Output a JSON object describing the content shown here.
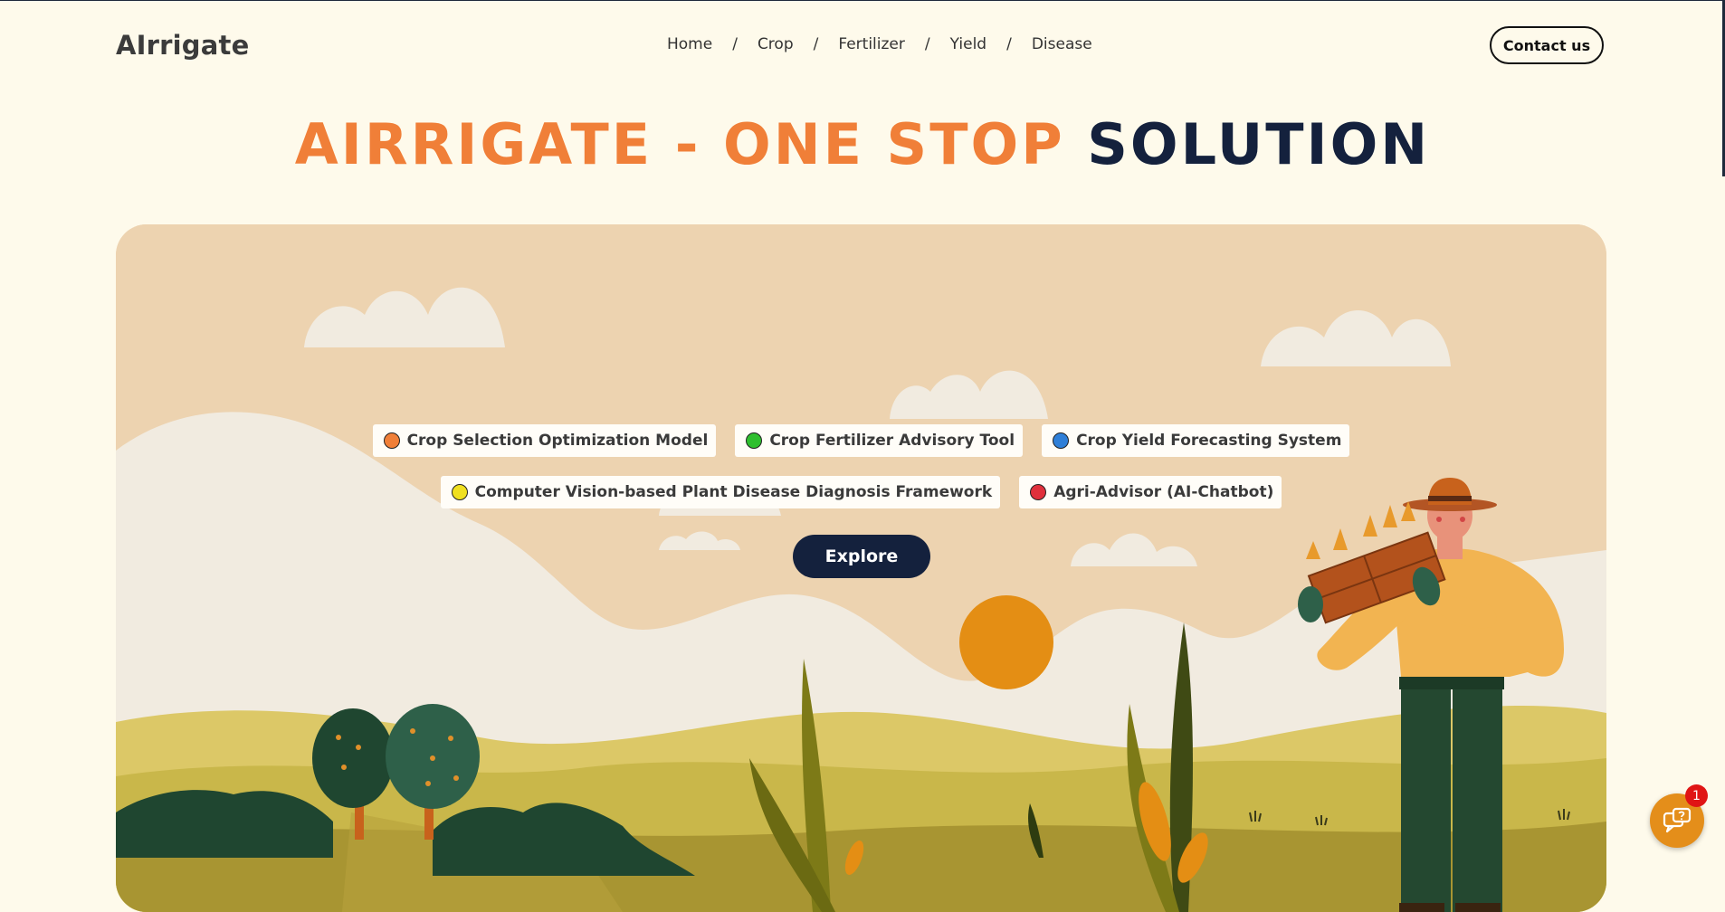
{
  "header": {
    "logo": "AIrrigate",
    "nav": [
      {
        "label": "Home"
      },
      {
        "label": "Crop"
      },
      {
        "label": "Fertilizer"
      },
      {
        "label": "Yield"
      },
      {
        "label": "Disease"
      }
    ],
    "separator": "/",
    "contact_label": "Contact us"
  },
  "hero": {
    "title_orange": "AIRRIGATE - ONE STOP ",
    "title_navy": "SOLUTION",
    "features_row1": [
      {
        "label": "Crop Selection Optimization Model",
        "color": "#f07f38"
      },
      {
        "label": "Crop Fertilizer Advisory Tool",
        "color": "#2fbf2f"
      },
      {
        "label": "Crop Yield Forecasting System",
        "color": "#2f7fd8"
      }
    ],
    "features_row2": [
      {
        "label": "Computer Vision-based Plant Disease Diagnosis Framework",
        "color": "#f0e020"
      },
      {
        "label": "Agri-Advisor (AI-Chatbot)",
        "color": "#e0303c"
      }
    ],
    "explore_label": "Explore"
  },
  "chat": {
    "icon": "chat-help-icon",
    "badge_count": "1"
  },
  "colors": {
    "accent": "#f07f38",
    "navy": "#14213d",
    "background": "#fefaeb"
  }
}
